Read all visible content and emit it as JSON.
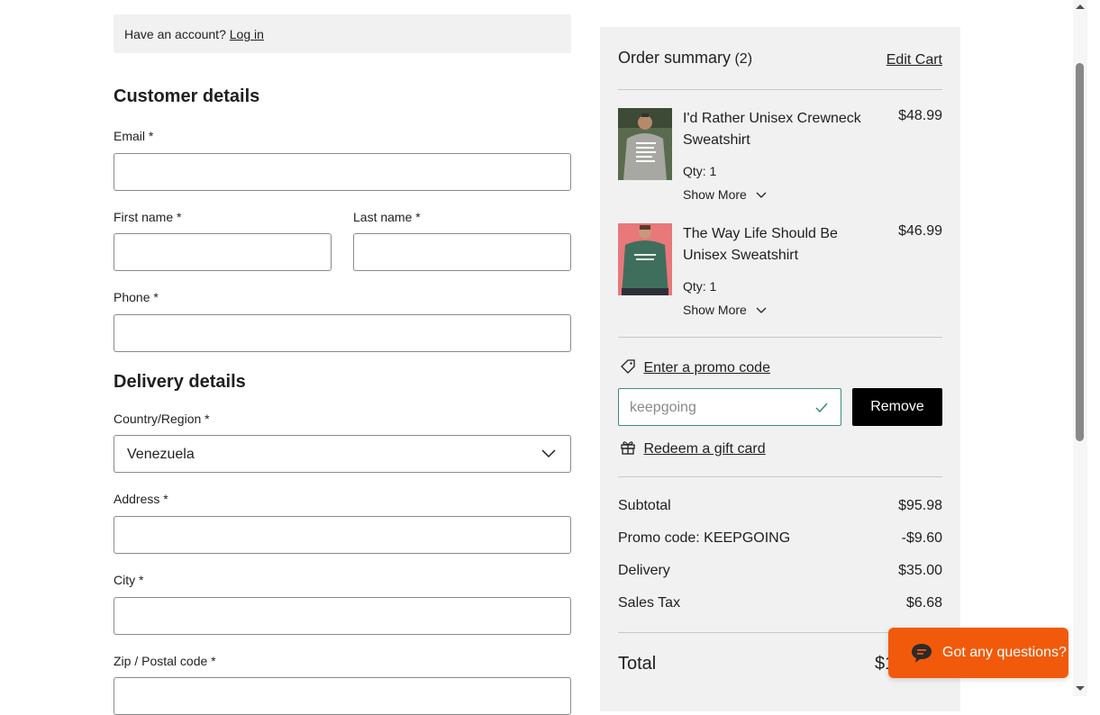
{
  "login": {
    "prompt": "Have an account?",
    "link": "Log in"
  },
  "customer": {
    "title": "Customer details",
    "email_label": "Email *",
    "first_name_label": "First name *",
    "last_name_label": "Last name *",
    "phone_label": "Phone *"
  },
  "delivery": {
    "title": "Delivery details",
    "country_label": "Country/Region *",
    "country_value": "Venezuela",
    "address_label": "Address *",
    "city_label": "City *",
    "zip_label": "Zip / Postal code *"
  },
  "summary": {
    "title": "Order summary",
    "count": "(2)",
    "edit_cart": "Edit Cart",
    "items": [
      {
        "name": "I'd Rather Unisex Crewneck Sweatshirt",
        "price": "$48.99",
        "qty": "Qty: 1",
        "show_more": "Show More",
        "thumb_color": "#6f6f66"
      },
      {
        "name": "The Way Life Should Be Unisex Sweatshirt",
        "price": "$46.99",
        "qty": "Qty: 1",
        "show_more": "Show More",
        "thumb_color": "#e86f70"
      }
    ],
    "promo_link": "Enter a promo code",
    "promo_value": "keepgoing",
    "remove_label": "Remove",
    "gift_link": "Redeem a gift card",
    "subtotal_label": "Subtotal",
    "subtotal_value": "$95.98",
    "promo_row_label": "Promo code: KEEPGOING",
    "promo_row_value": "-$9.60",
    "delivery_label": "Delivery",
    "delivery_value": "$35.00",
    "tax_label": "Sales Tax",
    "tax_value": "$6.68",
    "total_label": "Total",
    "total_value_visible": "$1"
  },
  "chat": {
    "label": "Got any questions?",
    "color": "#f15a0a"
  },
  "icons": {
    "chevron": "chevron-down-icon",
    "tag": "tag-icon",
    "gift": "gift-icon",
    "check": "checkmark-icon",
    "chat": "chat-bubble-icon"
  }
}
